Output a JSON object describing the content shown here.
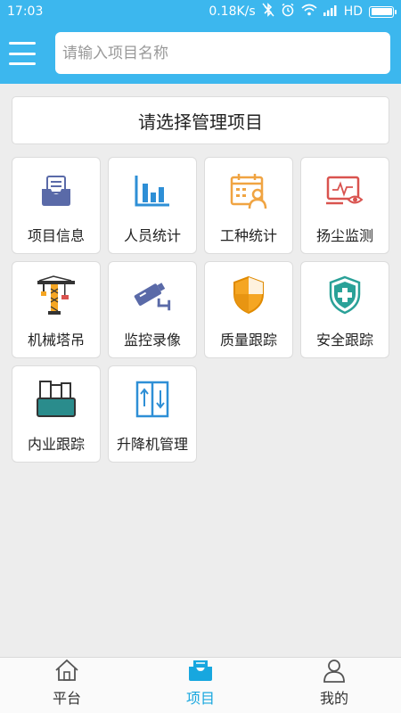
{
  "status": {
    "time": "17:03",
    "speed": "0.18K/s",
    "network": "HD"
  },
  "search": {
    "placeholder": "请输入项目名称"
  },
  "select_project": "请选择管理项目",
  "tiles": [
    {
      "label": "项目信息",
      "icon": "inbox-icon"
    },
    {
      "label": "人员统计",
      "icon": "bar-chart-icon"
    },
    {
      "label": "工种统计",
      "icon": "calendar-person-icon"
    },
    {
      "label": "扬尘监测",
      "icon": "monitor-eye-icon"
    },
    {
      "label": "机械塔吊",
      "icon": "tower-crane-icon"
    },
    {
      "label": "监控录像",
      "icon": "surveillance-camera-icon"
    },
    {
      "label": "质量跟踪",
      "icon": "shield-icon"
    },
    {
      "label": "安全跟踪",
      "icon": "shield-cross-icon"
    },
    {
      "label": "内业跟踪",
      "icon": "files-box-icon"
    },
    {
      "label": "升降机管理",
      "icon": "elevator-icon"
    }
  ],
  "nav": [
    {
      "label": "平台",
      "icon": "home-icon",
      "active": false
    },
    {
      "label": "项目",
      "icon": "tray-icon",
      "active": true
    },
    {
      "label": "我的",
      "icon": "user-icon",
      "active": false
    }
  ],
  "colors": {
    "accent": "#3cb7ee",
    "nav_active": "#17a7df"
  }
}
